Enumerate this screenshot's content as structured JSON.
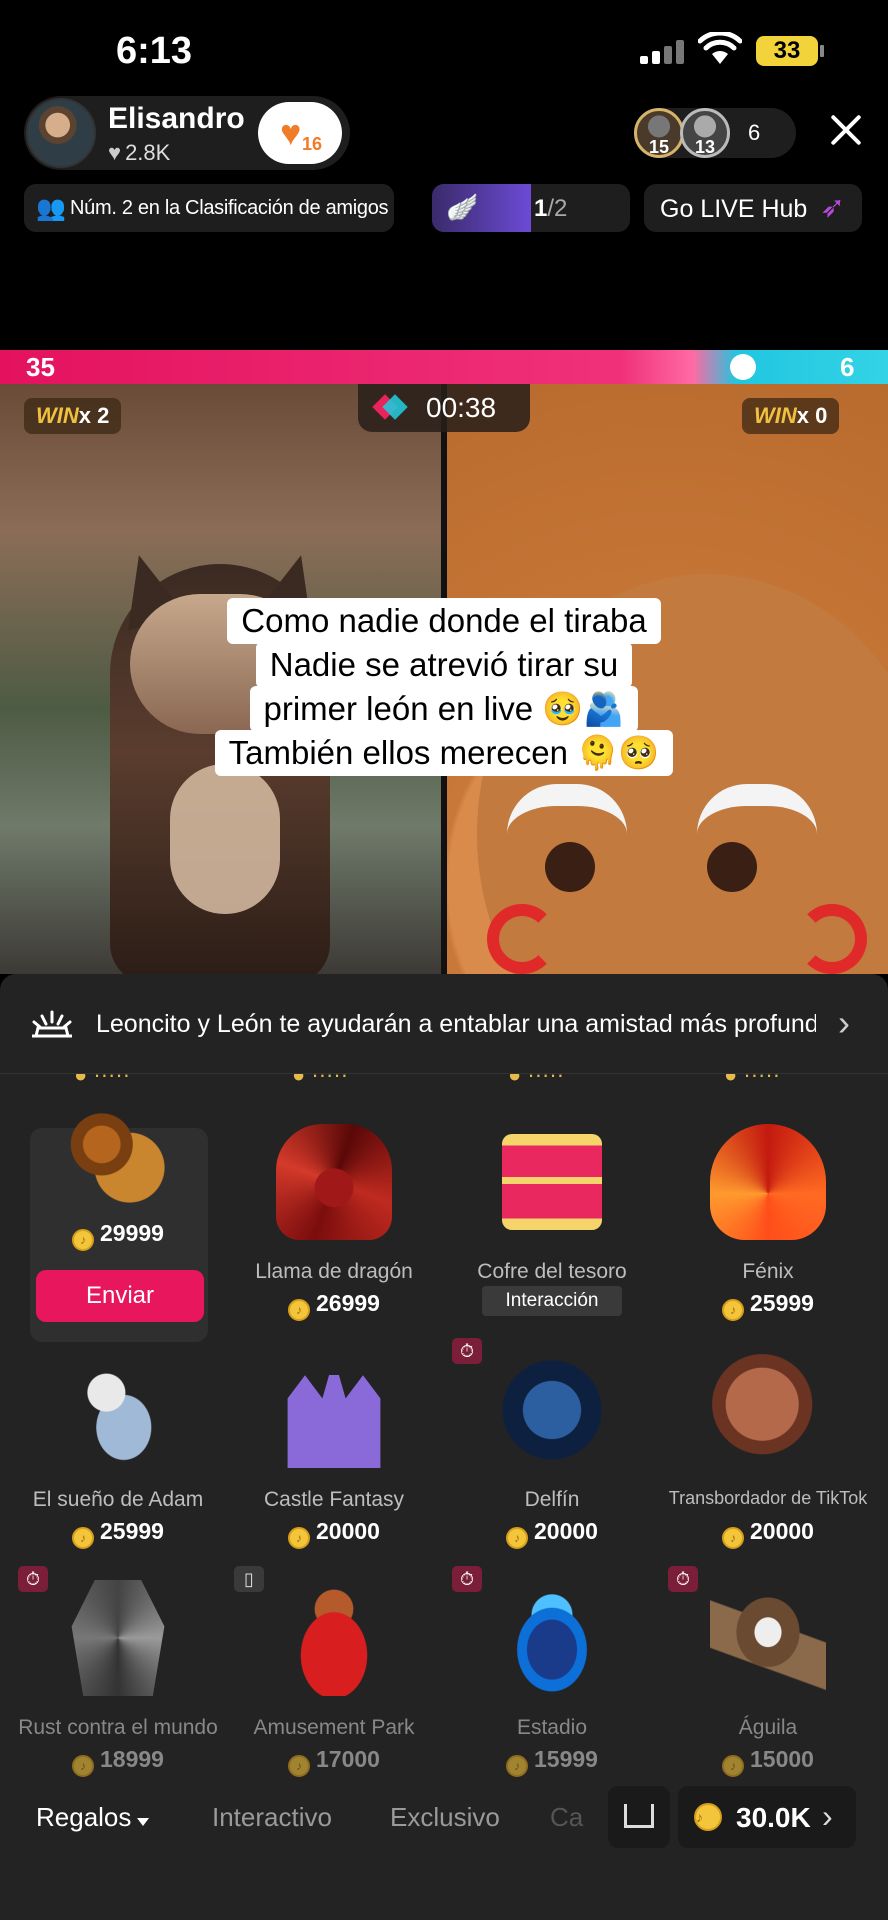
{
  "status": {
    "time": "6:13",
    "battery": "33"
  },
  "host": {
    "name": "Elisandro",
    "likes": "2.8K",
    "follow_count": "16"
  },
  "viewers": {
    "badge1": "15",
    "badge2": "13",
    "count": "6"
  },
  "rank": {
    "text": "Núm. 2 en la Clasificación de amigos"
  },
  "progress": {
    "current": "1",
    "total": "/2",
    "value_fraction": 0.5
  },
  "hub": {
    "label": "Go LIVE Hub"
  },
  "battle": {
    "left_score": "35",
    "right_score": "6",
    "timer": "00:38",
    "left_win_label": "WIN",
    "left_win_count": "x 2",
    "right_win_label": "WIN",
    "right_win_count": "x 0"
  },
  "caption": {
    "lines": [
      "Como nadie donde el tiraba",
      "Nadie se atrevió tirar su",
      "primer león en live 🥹🫂",
      "También ellos merecen 🫠🥺"
    ]
  },
  "banner": {
    "text": "Leoncito y León te ayudarán a entablar una amistad más profunda"
  },
  "gifts": [
    {
      "name": "",
      "price": "29999",
      "icon": "lion-icon",
      "action": "Enviar",
      "selected": true
    },
    {
      "name": "Llama de dragón",
      "price": "26999",
      "icon": "dragon-icon"
    },
    {
      "name": "Cofre del tesoro",
      "tag": "Interacción",
      "icon": "treasure-chest-icon"
    },
    {
      "name": "Fénix",
      "price": "25999",
      "icon": "phoenix-icon"
    },
    {
      "name": "El sueño de Adam",
      "price": "25999",
      "icon": "astronaut-icon"
    },
    {
      "name": "Castle Fantasy",
      "price": "20000",
      "icon": "castle-icon"
    },
    {
      "name": "Delfín",
      "price": "20000",
      "icon": "dolphin-icon",
      "badge": "timer"
    },
    {
      "name": "Transbordador de TikTok",
      "price": "20000",
      "icon": "shuttle-icon"
    },
    {
      "name": "Rust contra el mundo",
      "price": "18999",
      "icon": "robot-icon",
      "badge": "timer"
    },
    {
      "name": "Amusement Park",
      "price": "17000",
      "icon": "amusement-park-icon",
      "badge": "film"
    },
    {
      "name": "Estadio",
      "price": "15999",
      "icon": "stadium-icon",
      "badge": "timer"
    },
    {
      "name": "Águila",
      "price": "15000",
      "icon": "eagle-icon",
      "badge": "timer"
    }
  ],
  "tabs": {
    "gifts": "Regalos",
    "interactive": "Interactivo",
    "exclusive": "Exclusivo",
    "more": "Ca"
  },
  "wallet": {
    "coins": "30.0K"
  },
  "colors": {
    "accent": "#e8175d",
    "coin": "#f3c53b",
    "panel": "#232323"
  }
}
